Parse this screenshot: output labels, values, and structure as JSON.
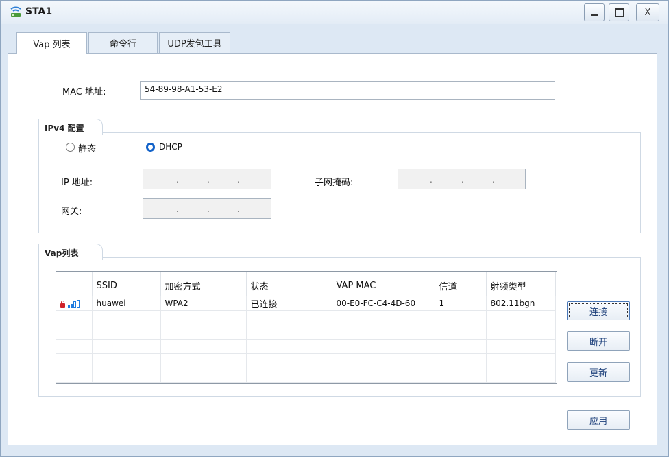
{
  "window": {
    "title": "STA1",
    "close_label": "X"
  },
  "tabs": [
    "Vap 列表",
    "命令行",
    "UDP发包工具"
  ],
  "mac": {
    "label": "MAC 地址:",
    "value": "54-89-98-A1-53-E2"
  },
  "ipv4": {
    "group_label": "IPv4 配置",
    "static_label": "静态",
    "dhcp_label": "DHCP",
    "selected": "DHCP",
    "ip_label": "IP 地址:",
    "mask_label": "子网掩码:",
    "gateway_label": "网关:",
    "ip_dots": [
      ".",
      ".",
      "."
    ],
    "mask_dots": [
      ".",
      ".",
      "."
    ],
    "gateway_dots": [
      ".",
      ".",
      "."
    ]
  },
  "vap": {
    "group_label": "Vap列表",
    "columns": [
      "",
      "SSID",
      "加密方式",
      "状态",
      "VAP MAC",
      "信道",
      "射频类型"
    ],
    "rows": [
      {
        "ssid": "huawei",
        "encryption": "WPA2",
        "status": "已连接",
        "vap_mac": "00-E0-FC-C4-4D-60",
        "channel": "1",
        "radio_type": "802.11bgn",
        "locked": true,
        "signal_bars": 2
      }
    ],
    "buttons": {
      "connect": "连接",
      "disconnect": "断开",
      "refresh": "更新"
    }
  },
  "apply_button": "应用",
  "colors": {
    "accent": "#1262c9",
    "lock": "#d0222a",
    "signal": "#1e7be0"
  }
}
